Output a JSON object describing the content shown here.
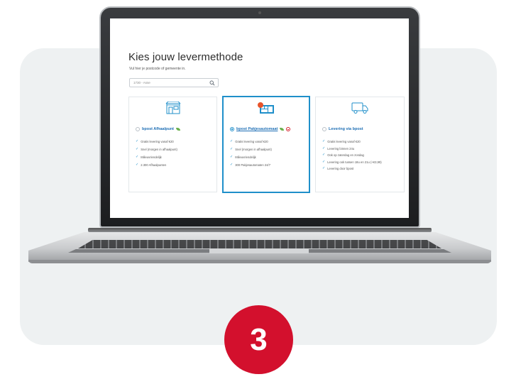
{
  "page": {
    "title": "Kies jouw levermethode",
    "subtitle": "Vul hier je postcode of gemeente in.",
    "search": {
      "value": "1730 - Asse",
      "icon": "search-icon"
    }
  },
  "options": [
    {
      "label": "bpost Afhaalpunt",
      "selected": false,
      "icon": "store-icon",
      "features": [
        "Gratis levering vanaf €20",
        "Snel (morgen in afhaalpunt)",
        "Milieuvriendelijk",
        "2.300 Afhaalpunten"
      ]
    },
    {
      "label": "bpost Pakjesautomaat",
      "selected": true,
      "icon": "parcel-locker-icon",
      "features": [
        "Gratis levering vanaf €20",
        "Snel (morgen in afhaalpunt)",
        "Milieuvriendelijk",
        "300 Pakjesautomaten 24/7"
      ]
    },
    {
      "label": "Levering via bpost",
      "selected": false,
      "icon": "delivery-truck-icon",
      "features": [
        "Gratis levering vanaf €20",
        "Levering binnen 24u",
        "Ook op zaterdag en zondag",
        "Levering ook tussen 18u en 21u (+€3,99)",
        "Levering door bpost"
      ]
    }
  ],
  "step": {
    "number": "3"
  },
  "colors": {
    "accent": "#1f8fca",
    "badge": "#d3102d",
    "panel": "#eef1f2"
  }
}
